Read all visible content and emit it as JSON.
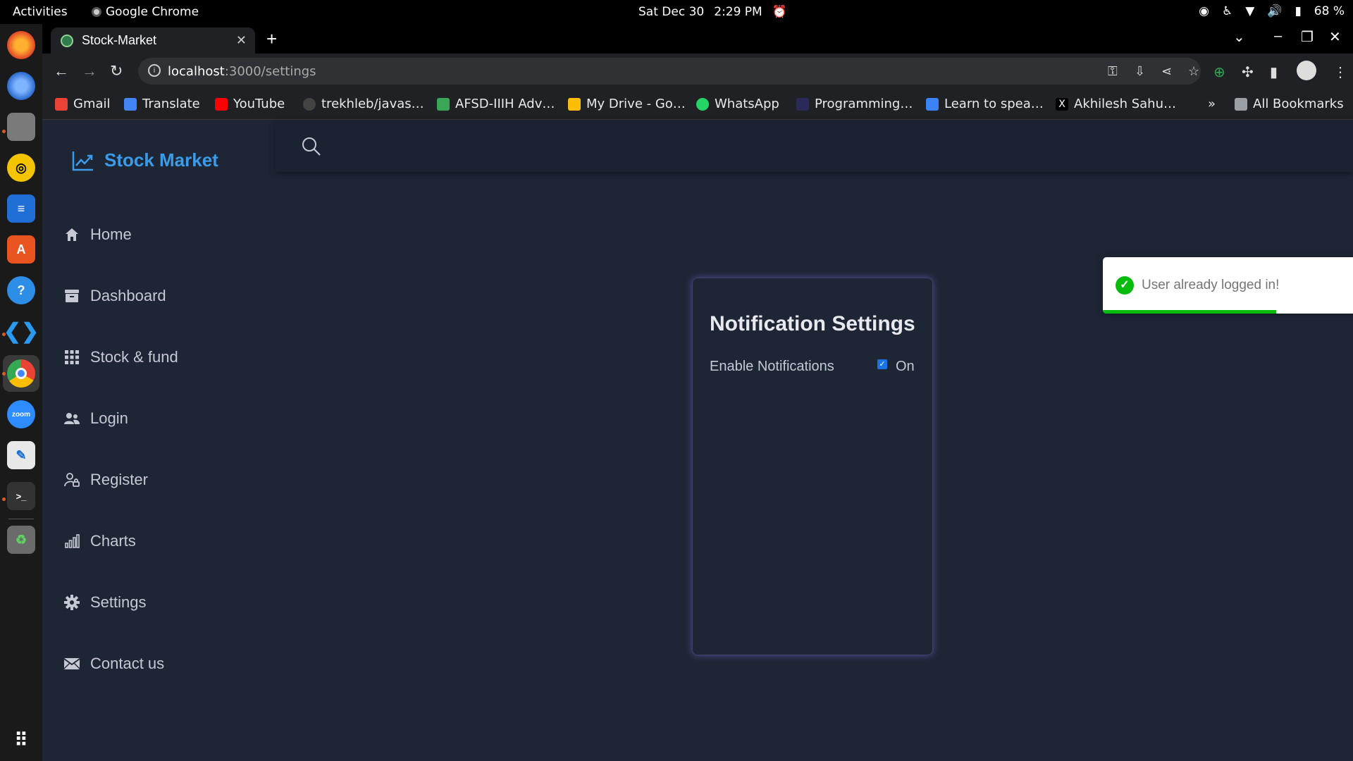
{
  "system_bar": {
    "activities": "Activities",
    "app_name": "Google Chrome",
    "date": "Sat Dec 30",
    "time": "2:29 PM",
    "battery": "68 %"
  },
  "dock": {
    "items": [
      "firefox-icon",
      "thunderbird-icon",
      "files-icon",
      "rhythmbox-icon",
      "writer-icon",
      "software-icon",
      "help-icon",
      "vscode-icon",
      "chrome-icon",
      "zoom-icon",
      "text-editor-icon",
      "terminal-icon",
      "trash-icon",
      "apps-grid-icon"
    ],
    "zoom_label": "zoom"
  },
  "browser": {
    "tab_title": "Stock-Market",
    "url_host": "localhost",
    "url_path": ":3000/settings",
    "bookmarks": [
      {
        "label": "Gmail",
        "color": "#ea4335"
      },
      {
        "label": "Translate",
        "color": "#4285f4"
      },
      {
        "label": "YouTube",
        "color": "#ff0000"
      },
      {
        "label": "trekhleb/javas…",
        "color": "#444444"
      },
      {
        "label": "AFSD-IIIH Adv…",
        "color": "#3aa757"
      },
      {
        "label": "My Drive - Go…",
        "color": "#fbbc04"
      },
      {
        "label": "WhatsApp",
        "color": "#25d366"
      },
      {
        "label": "Programming…",
        "color": "#2a2a5a"
      },
      {
        "label": "Learn to spea…",
        "color": "#3b82f6"
      },
      {
        "label": "Akhilesh Sahu…",
        "color": "#000000"
      }
    ],
    "all_bookmarks": "All Bookmarks"
  },
  "app": {
    "brand": "Stock Market",
    "nav": [
      "Home",
      "Dashboard",
      "Stock & fund",
      "Login",
      "Register",
      "Charts",
      "Settings",
      "Contact us"
    ],
    "card": {
      "title": "Notification Settings",
      "label": "Enable Notifications",
      "checked": true,
      "value": "On"
    },
    "toast": {
      "message": "User already logged in!",
      "progress": 0.63
    },
    "accent": "#3b9be8"
  }
}
